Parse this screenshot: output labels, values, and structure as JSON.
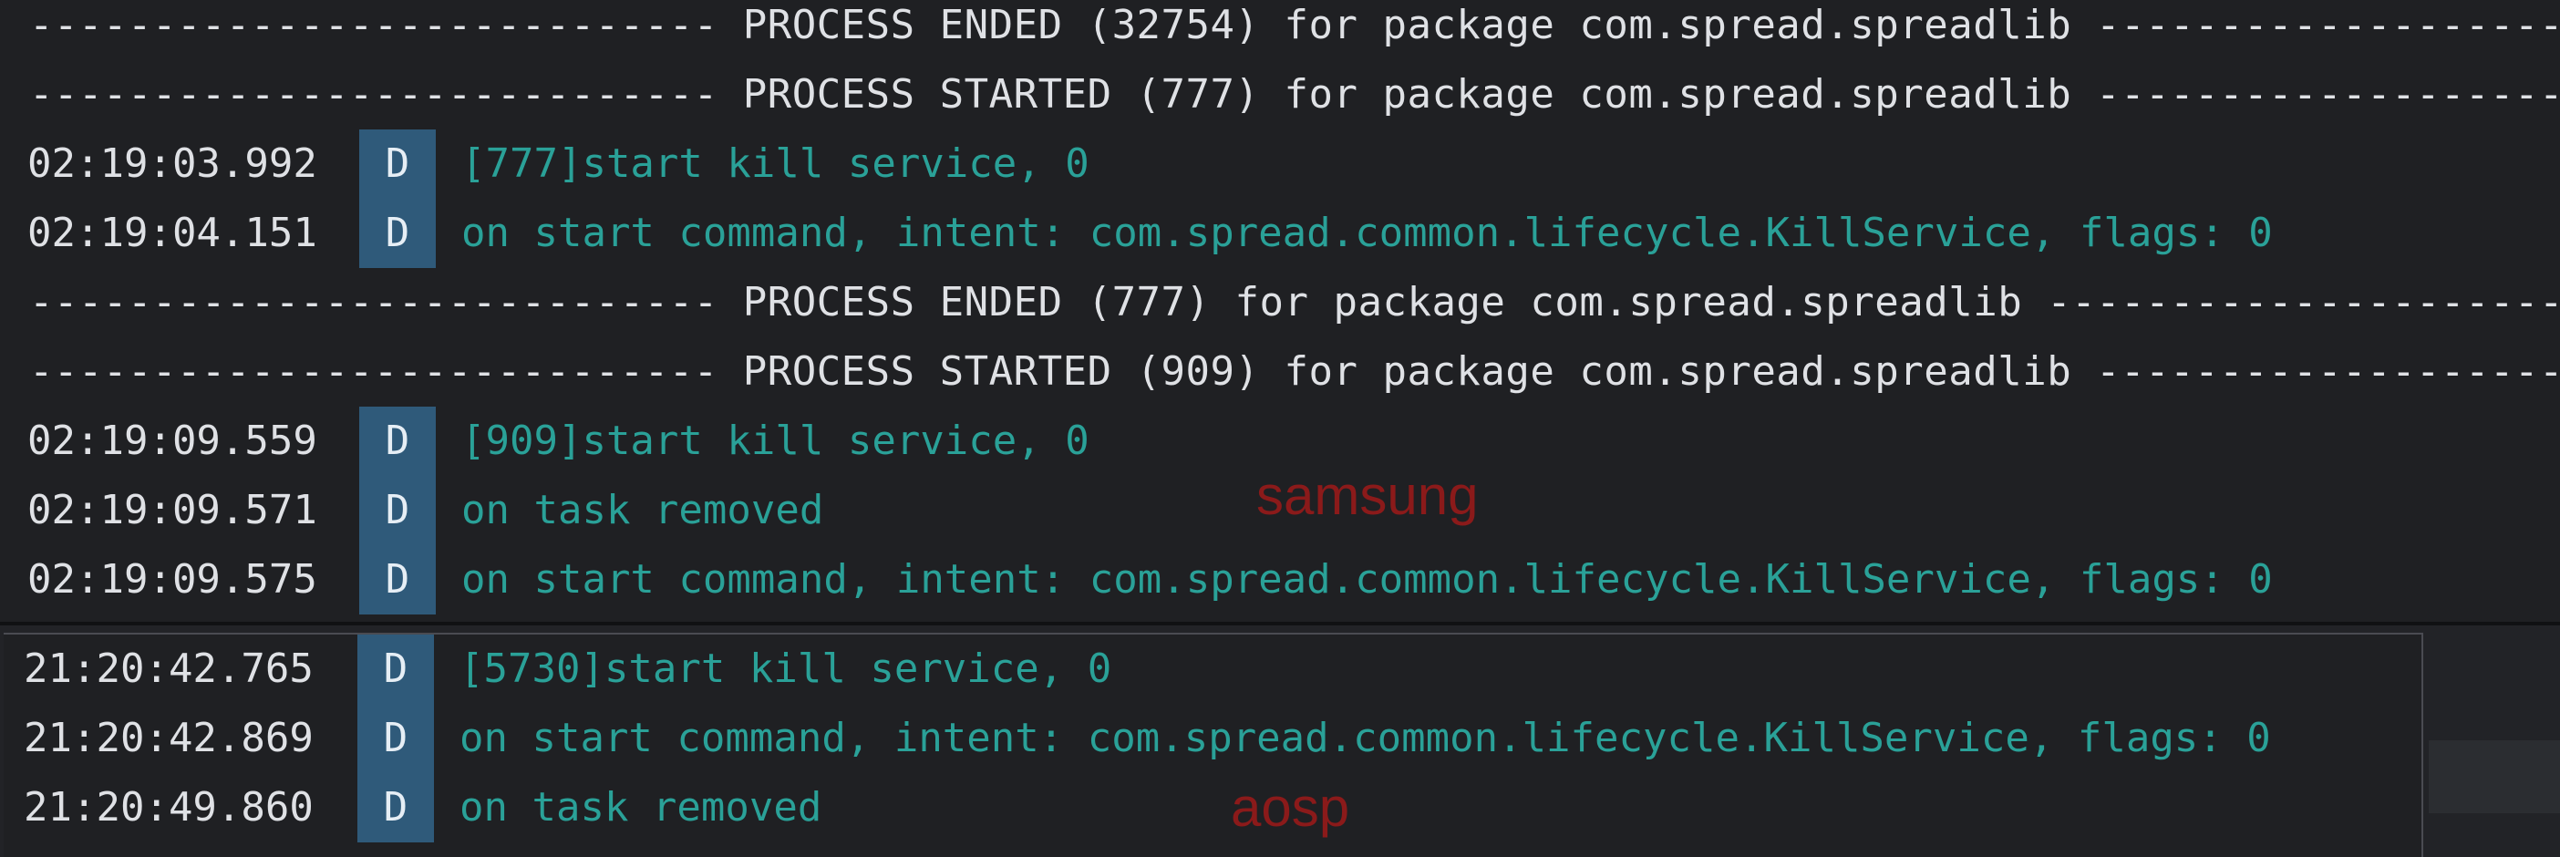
{
  "logcat_top": {
    "rows": [
      {
        "kind": "separator",
        "text": "---------------------------- PROCESS ENDED (32754) for package com.spread.spreadlib ------------------------"
      },
      {
        "kind": "separator",
        "text": "---------------------------- PROCESS STARTED (777) for package com.spread.spreadlib ------------------------"
      },
      {
        "kind": "log",
        "time": "02:19:03.992",
        "level": "D",
        "message": "[777]start kill service, 0"
      },
      {
        "kind": "log",
        "time": "02:19:04.151",
        "level": "D",
        "message": "on start command, intent: com.spread.common.lifecycle.KillService, flags: 0"
      },
      {
        "kind": "separator",
        "text": "---------------------------- PROCESS ENDED (777) for package com.spread.spreadlib --------------------------"
      },
      {
        "kind": "separator",
        "text": "---------------------------- PROCESS STARTED (909) for package com.spread.spreadlib ------------------------"
      },
      {
        "kind": "log",
        "time": "02:19:09.559",
        "level": "D",
        "message": "[909]start kill service, 0"
      },
      {
        "kind": "log",
        "time": "02:19:09.571",
        "level": "D",
        "message": "on task removed"
      },
      {
        "kind": "log",
        "time": "02:19:09.575",
        "level": "D",
        "message": "on start command, intent: com.spread.common.lifecycle.KillService, flags: 0"
      }
    ],
    "annotation": "samsung"
  },
  "logcat_bottom": {
    "rows": [
      {
        "kind": "log",
        "time": "21:20:42.765",
        "level": "D",
        "message": "[5730]start kill service, 0"
      },
      {
        "kind": "log",
        "time": "21:20:42.869",
        "level": "D",
        "message": "on start command, intent: com.spread.common.lifecycle.KillService, flags: 0"
      },
      {
        "kind": "log",
        "time": "21:20:49.860",
        "level": "D",
        "message": "on task removed"
      }
    ],
    "annotation": "aosp"
  },
  "colors": {
    "background": "#1f2023",
    "level_badge": "#2f5a7a",
    "message_text": "#2aa198",
    "annotation_text": "#8b1a1a"
  }
}
